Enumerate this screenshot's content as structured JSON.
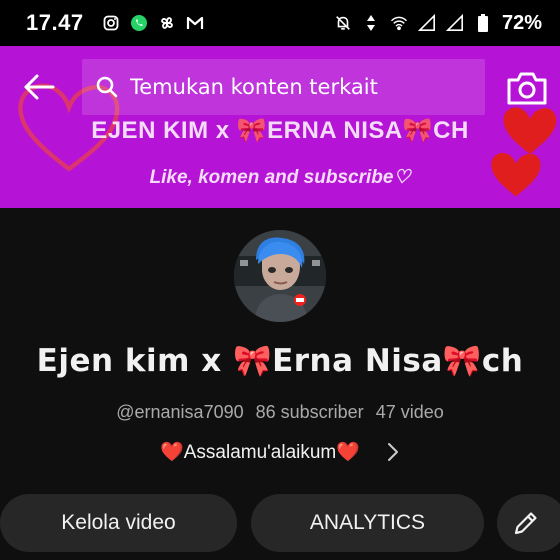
{
  "status_bar": {
    "time": "17.47",
    "battery": "72%",
    "icons": [
      "instagram-icon",
      "whatsapp-icon",
      "pinwheel-icon",
      "gmail-icon",
      "mute-icon",
      "data-arrows-icon",
      "wifi-icon",
      "signal-icon",
      "signal-icon",
      "battery-icon"
    ]
  },
  "banner": {
    "title": "EJEN KIM x 🎀ERNA NISA🎀CH",
    "subtitle": "Like, komen and subscribe♡",
    "background": "#b514d6"
  },
  "search": {
    "placeholder": "Temukan konten terkait"
  },
  "channel": {
    "name": "Ejen kim x 🎀Erna Nisa🎀ch",
    "handle": "@ernanisa7090",
    "subscribers": "86 subscriber",
    "videos": "47 video",
    "description": "❤️Assalamu'alaikum❤️"
  },
  "buttons": {
    "manage_videos": "Kelola video",
    "analytics": "ANALYTICS"
  },
  "colors": {
    "background": "#0f0f0f",
    "pill": "#272727",
    "meta_text": "#aaaaaa",
    "heart": "#e01e1e"
  }
}
